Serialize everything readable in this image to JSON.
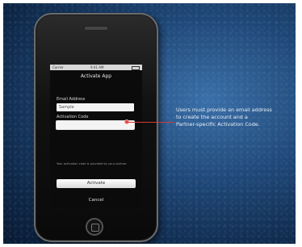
{
  "screen": {
    "title": "Activate App",
    "email_label": "Email Address",
    "email_value": "Sample",
    "code_label": "Activation Code",
    "code_value": "",
    "hint": "Your activation code is provided by your partner.",
    "activate_label": "Activate",
    "cancel_label": "Cancel"
  },
  "statusbar": {
    "carrier": "Carrier",
    "time": "9:41 AM"
  },
  "callout": {
    "line1": "Users must provide an email address",
    "line2": "to create the account and a",
    "line3": "Partner-specific Activation Code."
  },
  "colors": {
    "background": "#1f4878",
    "callout_line": "#d23a3a",
    "phone_body": "#111111"
  }
}
